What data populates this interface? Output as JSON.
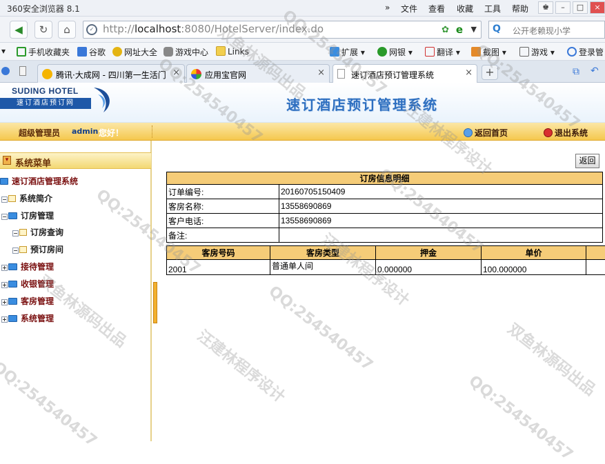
{
  "browser": {
    "title": "360安全浏览器 8.1",
    "menu": [
      "文件",
      "查看",
      "收藏",
      "工具",
      "帮助"
    ],
    "more": "»",
    "url_prefix": "http://",
    "url_host": "localhost",
    "url_rest": ":8080/HotelServer/index.do",
    "search_placeholder": "公开老赖现小学",
    "bookmarks": [
      "手机收藏夹",
      "谷歌",
      "网址大全",
      "游戏中心",
      "Links",
      "扩展",
      "网银",
      "翻译",
      "截图",
      "游戏",
      "登录管"
    ],
    "tabs": [
      {
        "label": "腾讯·大成网 - 四川第一生活门",
        "active": false
      },
      {
        "label": "应用宝官网",
        "active": false
      },
      {
        "label": "速订酒店预订管理系统",
        "active": true
      }
    ],
    "new_tab": "+"
  },
  "header": {
    "logo_text": "SUDING HOTEL",
    "logo_sub": "速订酒店预订网",
    "system_title": "速订酒店预订管理系统"
  },
  "userbar": {
    "role": "超级管理员",
    "username": "admin",
    "greeting": "您好！",
    "home_link": "返回首页",
    "logout_link": "退出系统"
  },
  "menu": {
    "header": "系统菜单",
    "root": "速订酒店管理系统",
    "items": [
      {
        "label": "系统简介",
        "level": 1,
        "type": "doc"
      },
      {
        "label": "订房管理",
        "level": 1,
        "type": "folder-open"
      },
      {
        "label": "订房查询",
        "level": 2,
        "type": "doc"
      },
      {
        "label": "预订房间",
        "level": 2,
        "type": "doc"
      },
      {
        "label": "接待管理",
        "level": 1,
        "type": "folder"
      },
      {
        "label": "收银管理",
        "level": 1,
        "type": "folder"
      },
      {
        "label": "客房管理",
        "level": 1,
        "type": "folder"
      },
      {
        "label": "系统管理",
        "level": 1,
        "type": "folder"
      }
    ]
  },
  "content": {
    "back_button": "返回",
    "detail_title": "订房信息明细",
    "detail_rows": [
      {
        "label": "订单编号:",
        "value": "20160705150409"
      },
      {
        "label": "客房名称:",
        "value": "13558690869"
      },
      {
        "label": "客户电话:",
        "value": "13558690869"
      },
      {
        "label": "备注:",
        "value": ""
      }
    ],
    "room_columns": [
      "客房号码",
      "客房类型",
      "押金",
      "单价",
      ""
    ],
    "room_rows": [
      [
        "2001",
        "普通单人间",
        "0.000000",
        "100.000000",
        ""
      ]
    ]
  },
  "watermarks": [
    "QQ:254540457",
    "汪建林程序设计",
    "双鱼林源码出品"
  ],
  "colors": {
    "table_header": "#f5cc78",
    "userbar": "#f5c84e",
    "title_blue": "#2e6fc0"
  }
}
